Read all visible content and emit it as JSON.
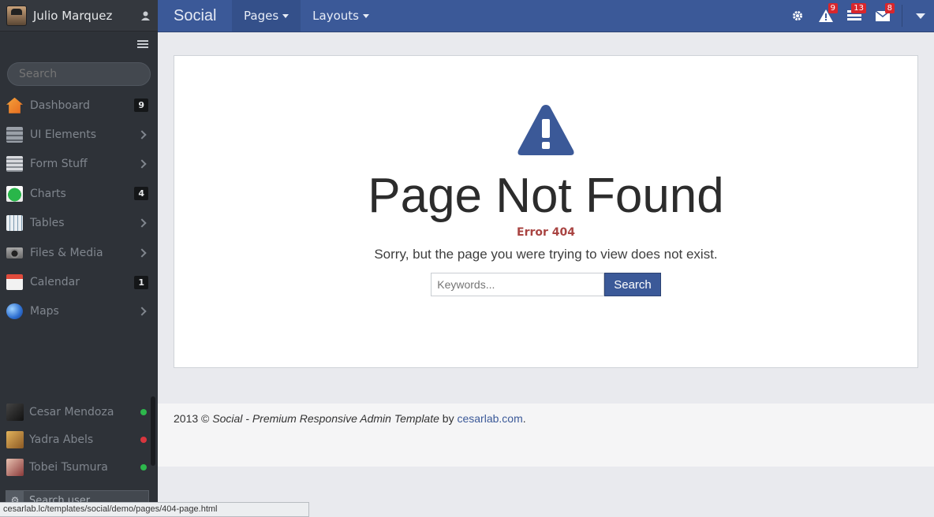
{
  "sidebar": {
    "user_name": "Julio Marquez",
    "search_placeholder": "Search",
    "items": [
      {
        "label": "Dashboard",
        "count": "9",
        "icon": "home-icon"
      },
      {
        "label": "UI Elements",
        "icon": "ui-elements-icon"
      },
      {
        "label": "Form Stuff",
        "icon": "form-icon"
      },
      {
        "label": "Charts",
        "count": "4",
        "icon": "chart-icon"
      },
      {
        "label": "Tables",
        "icon": "table-icon"
      },
      {
        "label": "Files & Media",
        "icon": "camera-icon"
      },
      {
        "label": "Calendar",
        "count": "1",
        "icon": "calendar-icon"
      },
      {
        "label": "Maps",
        "icon": "globe-icon"
      }
    ],
    "contacts": [
      {
        "name": "Cesar Mendoza",
        "status_color": "#2db84c"
      },
      {
        "name": "Yadra Abels",
        "status_color": "#d9363e"
      },
      {
        "name": "Tobei Tsumura",
        "status_color": "#2db84c"
      }
    ],
    "user_search_placeholder": "Search user..."
  },
  "topbar": {
    "brand": "Social",
    "nav": [
      {
        "label": "Pages"
      },
      {
        "label": "Layouts"
      }
    ],
    "badges": {
      "alerts": "9",
      "tasks": "13",
      "messages": "8"
    }
  },
  "main": {
    "title": "Page Not Found",
    "error_code": "Error 404",
    "message": "Sorry, but the page you were trying to view does not exist.",
    "search_placeholder": "Keywords...",
    "search_button": "Search"
  },
  "footer": {
    "prefix": "2013 © ",
    "brand": "Social",
    "tagline": " - Premium Responsive Admin Template",
    "by": " by ",
    "link": "cesarlab.com",
    "suffix": "."
  },
  "status_url": "cesarlab.lc/templates/social/demo/pages/404-page.html",
  "colors": {
    "brand": "#3b5998",
    "sidebar": "#2e3238",
    "error": "#a94442",
    "badge": "#d9262c"
  }
}
